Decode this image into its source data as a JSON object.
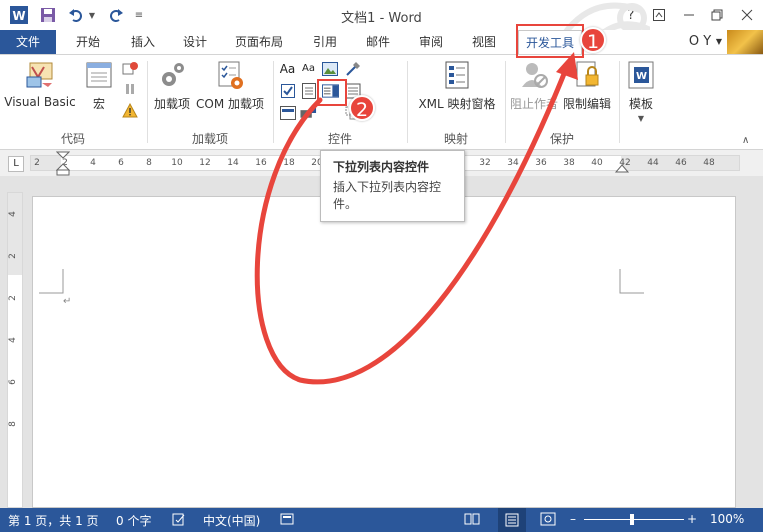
{
  "window": {
    "title": "文档1 - Word",
    "app_icon": "W",
    "help": "?",
    "user": "O Y"
  },
  "tabs": [
    {
      "id": "file",
      "label": "文件"
    },
    {
      "id": "home",
      "label": "开始"
    },
    {
      "id": "insert",
      "label": "插入"
    },
    {
      "id": "design",
      "label": "设计"
    },
    {
      "id": "layout",
      "label": "页面布局"
    },
    {
      "id": "references",
      "label": "引用"
    },
    {
      "id": "mailings",
      "label": "邮件"
    },
    {
      "id": "review",
      "label": "审阅"
    },
    {
      "id": "view",
      "label": "视图"
    },
    {
      "id": "developer",
      "label": "开发工具"
    }
  ],
  "ribbon": {
    "visual_basic": "Visual Basic",
    "macro": "宏",
    "addins": "加载项",
    "com_addins": "COM 加载项",
    "xml_mapping": "XML 映射窗格",
    "block_authors": "阻止作者",
    "restrict_editing": "限制编辑",
    "template": "模板",
    "group_code": "代码",
    "group_addins": "加载项",
    "group_controls": "控件",
    "group_mapping": "映射",
    "group_protect": "保护"
  },
  "ruler": {
    "corner": "L",
    "h_ticks": [
      "2",
      "2",
      "4",
      "6",
      "8",
      "10",
      "12",
      "14",
      "16",
      "18",
      "20",
      "22",
      "24",
      "26",
      "28",
      "30",
      "32",
      "34",
      "36",
      "38",
      "40",
      "42",
      "44",
      "46",
      "48"
    ],
    "v_ticks": [
      "4",
      "2",
      "2",
      "4",
      "6",
      "8"
    ]
  },
  "tooltip": {
    "title": "下拉列表内容控件",
    "body": "插入下拉列表内容控件。"
  },
  "annotations": {
    "badge1": "1",
    "badge2": "2"
  },
  "statusbar": {
    "page": "第 1 页，共 1 页",
    "words": "0 个字",
    "language": "中文(中国)",
    "zoom": "100%"
  },
  "colors": {
    "brand": "#2b579a",
    "annotation": "#e8453c"
  }
}
